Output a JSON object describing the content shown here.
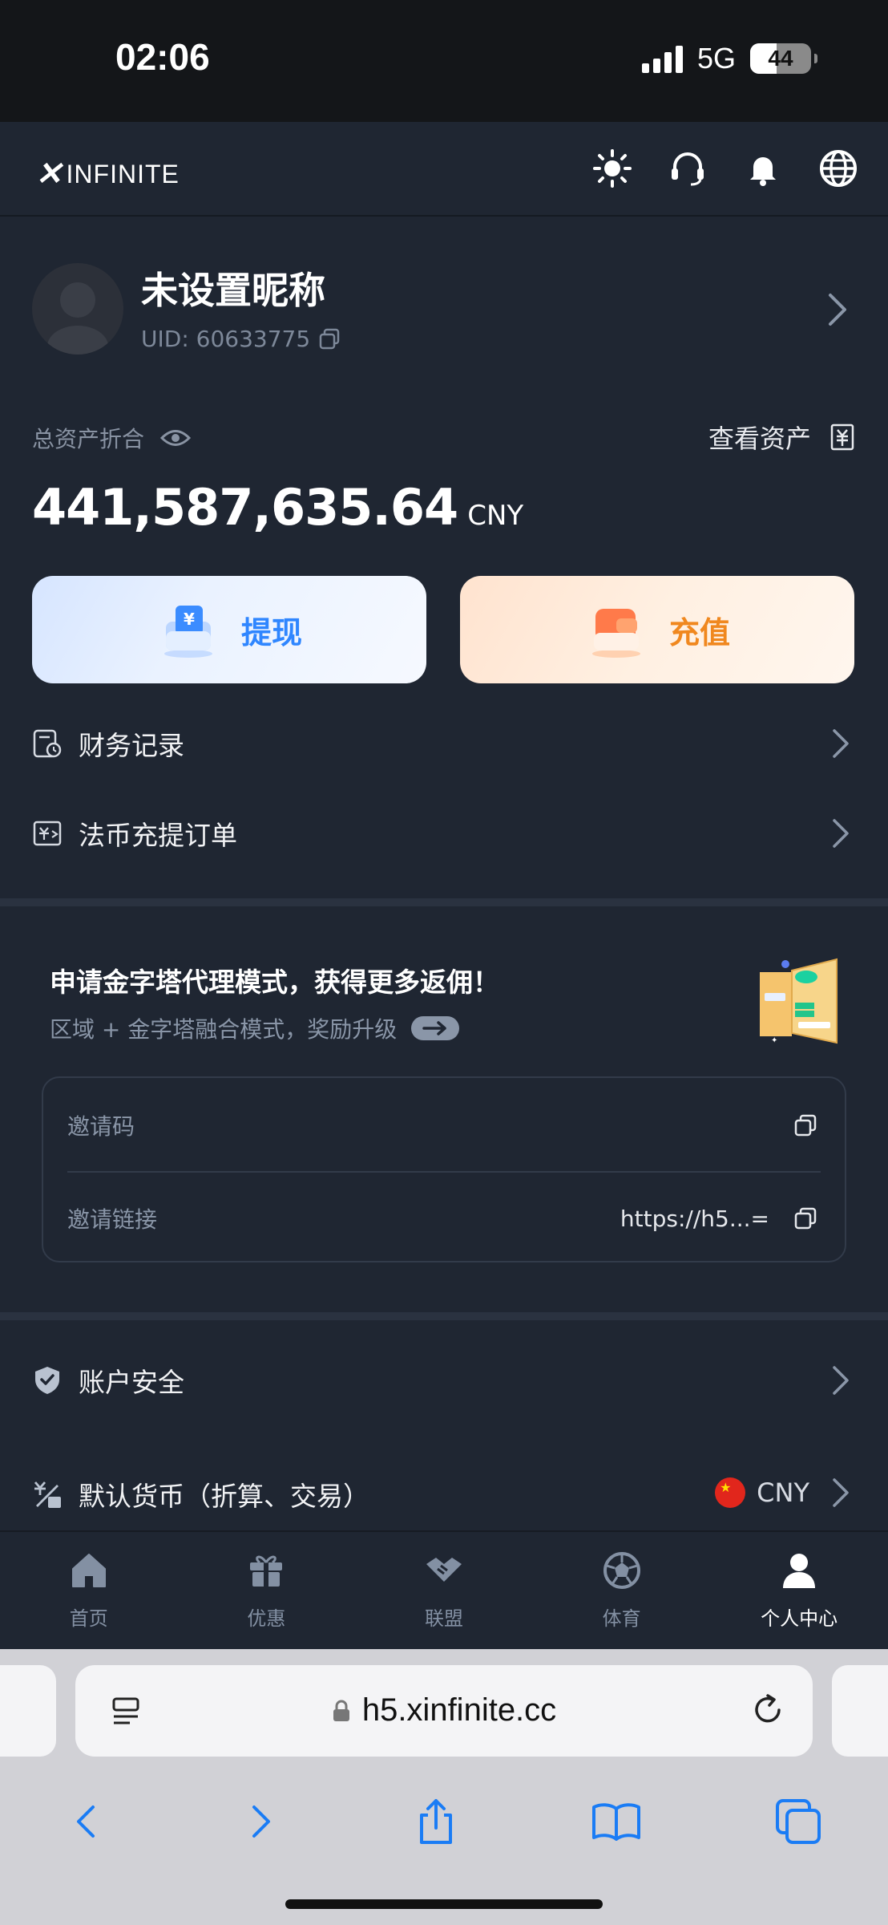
{
  "status_bar": {
    "time": "02:06",
    "network": "5G",
    "battery": "44",
    "battery_level_percent": 44
  },
  "header": {
    "logo_text": "INFINITE",
    "icons": [
      "sun-icon",
      "headset-icon",
      "bell-icon",
      "globe-icon"
    ]
  },
  "profile": {
    "nickname": "未设置昵称",
    "uid": "UID: 60633775"
  },
  "assets": {
    "label": "总资产折合",
    "view_label": "查看资产",
    "amount": "441,587,635.64",
    "unit": "CNY"
  },
  "actions": {
    "withdraw": "提现",
    "deposit": "充值"
  },
  "menu": {
    "finance_records": "财务记录",
    "fiat_orders": "法币充提订单"
  },
  "agent": {
    "title": "申请金字塔代理模式，获得更多返佣！",
    "subtitle": "区域 + 金字塔融合模式，奖励升级",
    "invite_code_label": "邀请码",
    "invite_code_value": "",
    "invite_link_label": "邀请链接",
    "invite_link_value": "https://h5...="
  },
  "settings": {
    "security": "账户安全",
    "currency": "默认货币（折算、交易）",
    "currency_code": "CNY"
  },
  "tabs": [
    {
      "label": "首页",
      "icon": "home-icon"
    },
    {
      "label": "优惠",
      "icon": "gift-icon"
    },
    {
      "label": "联盟",
      "icon": "handshake-icon"
    },
    {
      "label": "体育",
      "icon": "soccer-ball-icon"
    },
    {
      "label": "个人中心",
      "icon": "person-icon",
      "active": true
    }
  ],
  "browser": {
    "url": "h5.xinfinite.cc"
  },
  "colors": {
    "background": "#1f2632",
    "withdraw_accent": "#2f86ff",
    "deposit_accent": "#f0881f"
  }
}
